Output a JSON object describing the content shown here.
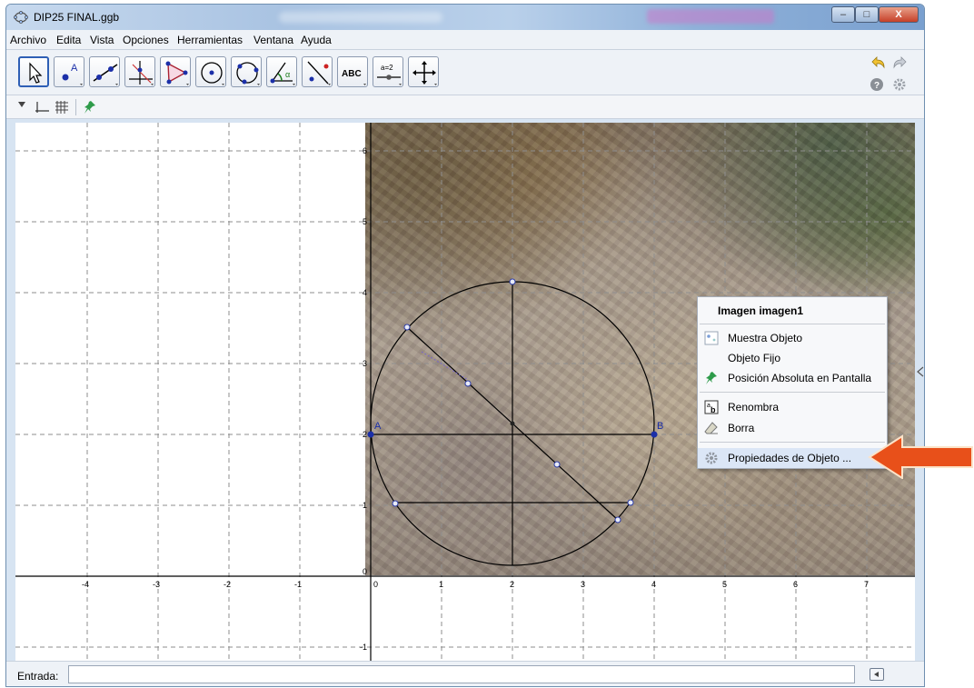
{
  "window": {
    "title": "DIP25 FINAL.ggb",
    "controls": {
      "minimize": "–",
      "maximize": "□",
      "close": "X"
    }
  },
  "menu": [
    "Archivo",
    "Edita",
    "Vista",
    "Opciones",
    "Herramientas",
    "Ventana",
    "Ayuda"
  ],
  "toolbar": {
    "tools": [
      {
        "name": "move-tool",
        "icon": "pointer-icon",
        "selected": true
      },
      {
        "name": "point-tool",
        "icon": "point-a-icon",
        "label": "A"
      },
      {
        "name": "line-tool",
        "icon": "line-through-points-icon"
      },
      {
        "name": "perpendicular-tool",
        "icon": "perpendicular-line-icon"
      },
      {
        "name": "polygon-tool",
        "icon": "polygon-icon"
      },
      {
        "name": "circle-tool",
        "icon": "circle-center-point-icon"
      },
      {
        "name": "conic-tool",
        "icon": "circle-three-points-icon"
      },
      {
        "name": "angle-tool",
        "icon": "angle-icon"
      },
      {
        "name": "reflect-tool",
        "icon": "reflect-icon"
      },
      {
        "name": "text-tool",
        "icon": "text-icon",
        "label": "ABC"
      },
      {
        "name": "slider-tool",
        "icon": "slider-icon",
        "label": "a=2"
      },
      {
        "name": "move-view-tool",
        "icon": "move-graphics-icon"
      }
    ],
    "right_icons": [
      "undo-icon",
      "redo-icon",
      "help-icon",
      "gear-icon"
    ]
  },
  "stylebar": {
    "icons": [
      "axes-icon",
      "grid-icon",
      "pin-icon"
    ]
  },
  "graphics": {
    "x_ticks": [
      "-4",
      "-3",
      "-2",
      "-1",
      "0",
      "1",
      "2",
      "3",
      "4",
      "5",
      "6",
      "7"
    ],
    "y_ticks": [
      "0",
      "1",
      "2",
      "3",
      "4",
      "5",
      "6",
      "-1"
    ],
    "point_labels": {
      "A": "A",
      "B": "B"
    }
  },
  "context_menu": {
    "title": "Imagen imagen1",
    "items": [
      {
        "label": "Muestra Objeto",
        "icon": "show-object-icon"
      },
      {
        "label": "Objeto Fijo",
        "icon": ""
      },
      {
        "label": "Posición Absoluta en Pantalla",
        "icon": "pin-icon"
      },
      {
        "label": "Renombra",
        "icon": "rename-icon"
      },
      {
        "label": "Borra",
        "icon": "eraser-icon"
      },
      {
        "label": "Propiedades de Objeto ...",
        "icon": "gear-icon"
      }
    ]
  },
  "input_bar": {
    "label": "Entrada:",
    "value": ""
  },
  "colors": {
    "arrow": "#e8501a",
    "selection": "#2e5fb5",
    "axis": "#000000",
    "grid": "#9a9a9a"
  }
}
